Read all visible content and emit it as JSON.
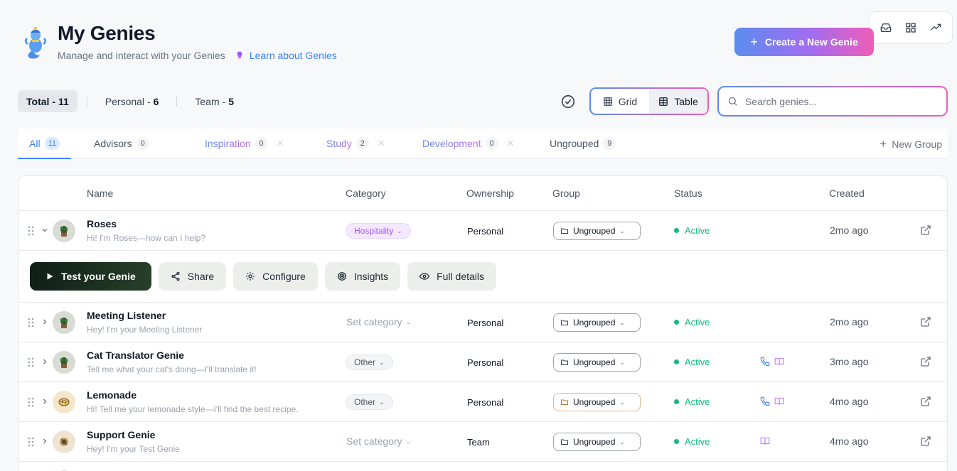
{
  "header": {
    "title": "My Genies",
    "subtitle": "Manage and interact with your Genies",
    "learn_link": "Learn about Genies",
    "create_button": "Create a New Genie"
  },
  "counts": {
    "total": {
      "label": "Total -",
      "value": "11"
    },
    "personal": {
      "label": "Personal -",
      "value": "6"
    },
    "team": {
      "label": "Team -",
      "value": "5"
    }
  },
  "view_toggle": {
    "grid": "Grid",
    "table": "Table",
    "selected": "Table"
  },
  "search": {
    "placeholder": "Search genies..."
  },
  "tabs": [
    {
      "label": "All",
      "count": "11"
    },
    {
      "label": "Advisors",
      "count": "0"
    },
    {
      "label": "Inspiration",
      "count": "0"
    },
    {
      "label": "Study",
      "count": "2"
    },
    {
      "label": "Development",
      "count": "0"
    },
    {
      "label": "Ungrouped",
      "count": "9"
    }
  ],
  "new_group": "New Group",
  "columns": {
    "name": "Name",
    "category": "Category",
    "ownership": "Ownership",
    "group": "Group",
    "status": "Status",
    "created": "Created"
  },
  "actions": {
    "test": "Test your Genie",
    "share": "Share",
    "configure": "Configure",
    "insights": "Insights",
    "details": "Full details"
  },
  "rows": [
    {
      "name": "Roses",
      "desc": "Hi! I'm Roses—how can I help?",
      "category": "Hospitality",
      "ownership": "Personal",
      "group": "Ungrouped",
      "status": "Active",
      "created": "2mo ago"
    },
    {
      "name": "Meeting Listener",
      "desc": "Hey! I'm your Meeting Listener",
      "category": "Set category",
      "ownership": "Personal",
      "group": "Ungrouped",
      "status": "Active",
      "created": "2mo ago"
    },
    {
      "name": "Cat Translator Genie",
      "desc": "Tell me what your cat's doing—I'll translate it!",
      "category": "Other",
      "ownership": "Personal",
      "group": "Ungrouped",
      "status": "Active",
      "created": "3mo ago"
    },
    {
      "name": "Lemonade",
      "desc": "Hi! Tell me your lemonade style—I'll find the best recipe.",
      "category": "Other",
      "ownership": "Personal",
      "group": "Ungrouped",
      "status": "Active",
      "created": "4mo ago"
    },
    {
      "name": "Support Genie",
      "desc": "Hey! I'm your Test Genie",
      "category": "Set category",
      "ownership": "Team",
      "group": "Ungrouped",
      "status": "Active",
      "created": "4mo ago"
    }
  ],
  "colors": {
    "accent": "#3b82f6",
    "active": "#10b981",
    "gradient_start": "#5b8def",
    "gradient_end": "#ee5db8"
  }
}
